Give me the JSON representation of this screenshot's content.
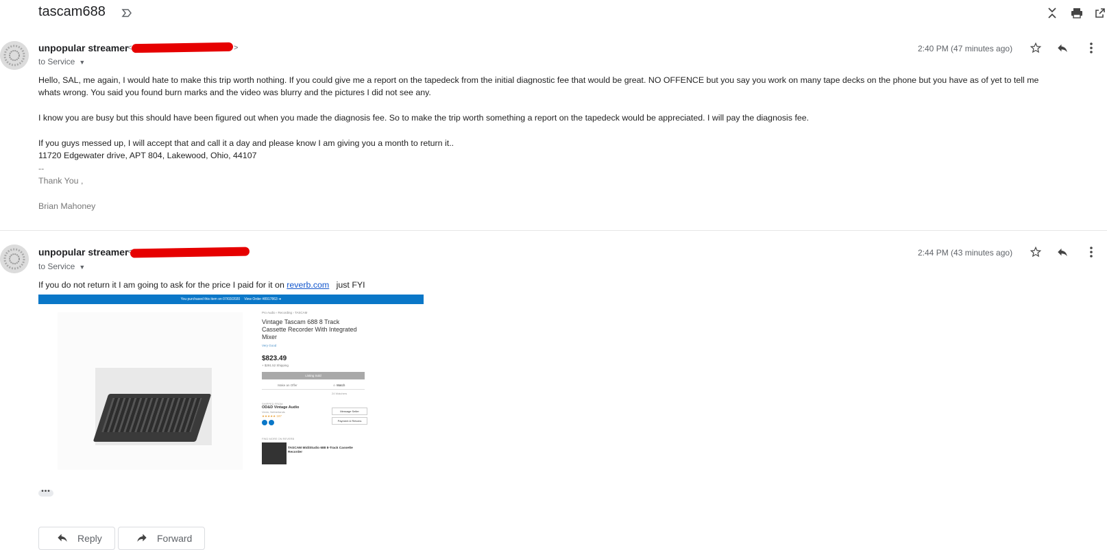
{
  "subject": "tascam688",
  "toolbar": {
    "icons": [
      "collapse-icon",
      "print-icon",
      "open-new-window-icon"
    ]
  },
  "messages": [
    {
      "sender": "unpopular streamer",
      "addr_open": "<",
      "addr_close": ">",
      "to": "to Service",
      "time": "2:40 PM (47 minutes ago)",
      "lines": [
        "Hello, SAL, me again, I would hate to make this trip worth nothing. If you could give me a report on the tapedeck from the initial diagnostic fee that would be great. NO OFFENCE but you say you work on many tape decks on the phone but you have as of yet to tell me",
        "whats wrong. You said you found burn marks and the video was blurry and the pictures I did not see any.",
        "I know you are busy but this should have been figured out when you made the diagnosis fee. So to make the trip worth something a report on the tapedeck would be appreciated. I will pay the diagnosis fee.",
        "If you guys messed up, I will accept that and call it a day and please know I am giving you a month to return it..",
        "11720 Edgewater drive, APT 804, Lakewood, Ohio, 44107",
        "--",
        "Thank You ,",
        "Brian Mahoney"
      ]
    },
    {
      "sender": "unpopular streamer",
      "addr_open": "<",
      "to": "to Service",
      "time": "2:44 PM (43 minutes ago)",
      "text_before": "If you do not return it I am going to ask for the price I paid for it on ",
      "link": "reverb.com",
      "text_after": "   just FYI"
    }
  ],
  "attachment": {
    "banner_left": "You purchased this item on 07/03/2020",
    "banner_right": "View Order #8917863 ➜",
    "crumb": "Pro Audio  ›  Recording  ›  TASCAM",
    "title": "Vintage Tascam 688 8 Track Cassette Recorder With Integrated Mixer",
    "condition": "Very Good",
    "price": "$823.49",
    "price_sub": "+ $291.52 Shipping",
    "listing_btn": "Listing Sold",
    "make_offer": "Make an Offer",
    "watch": "☆ Watch",
    "watchers": "24 Watchers",
    "shipped_from": "SHIPPED FROM",
    "shop": "OD&D Vintage Audio",
    "shop_loc": "Venlo, Netherlands",
    "stars": "★★★★★  187",
    "message_seller": "Message Seller",
    "payment": "Payment & Returns",
    "find_more": "FIND MORE ON REVERB",
    "related": "TASCAM MidiStudio 688 8-Track Cassette Recorder"
  },
  "more": "•••",
  "buttons": {
    "reply": "Reply",
    "forward": "Forward"
  }
}
